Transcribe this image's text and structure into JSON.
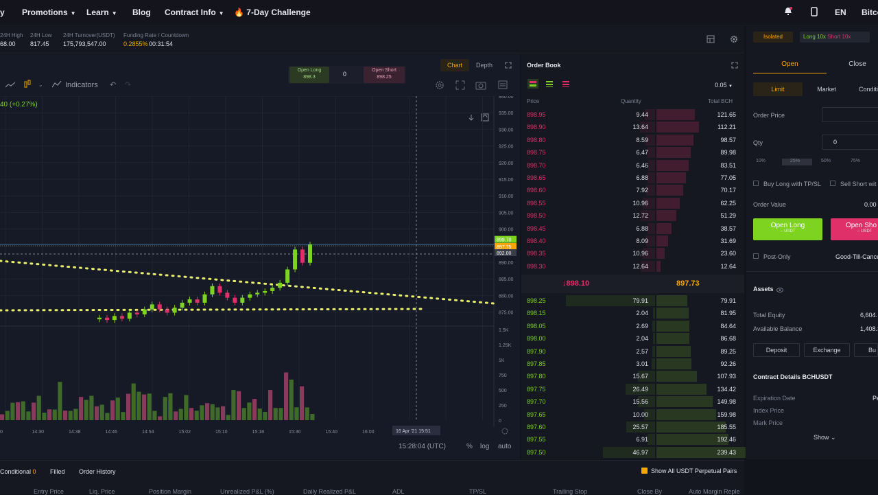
{
  "nav": {
    "brand_fragment": "y",
    "items": [
      {
        "label": "Promotions",
        "caret": true
      },
      {
        "label": "Learn",
        "caret": true
      },
      {
        "label": "Blog",
        "caret": false
      },
      {
        "label": "Contract Info",
        "caret": true
      },
      {
        "label": "7-Day Challenge",
        "caret": false,
        "icon": "fire-icon"
      }
    ],
    "lang": "EN",
    "account": "Bitco"
  },
  "ticker": {
    "high_label": "24H High",
    "high_value": "68.00",
    "low_label": "24H Low",
    "low_value": "817.45",
    "turnover_label": "24H Turnover(USDT)",
    "turnover_value": "175,793,547.00",
    "funding_label": "Funding Rate / Countdown",
    "funding_rate": "0.2855%",
    "countdown": "00:31:54"
  },
  "chart": {
    "indicators_label": "Indicators",
    "change_text": "40 (+0.27%)",
    "open_long_label": "Open Long",
    "open_long_price": "898.3",
    "qty_value": "0",
    "open_short_label": "Open Short",
    "open_short_price": "898.25",
    "tab_chart": "Chart",
    "tab_depth": "Depth",
    "clock": "15:28:04 (UTC)",
    "scale_pct": "%",
    "scale_log": "log",
    "scale_auto": "auto",
    "crosshair_date": "16 Apr '21",
    "crosshair_time": "15:51"
  },
  "chart_data": {
    "type": "candlestick",
    "y_ticks": [
      "940.00",
      "935.00",
      "930.00",
      "925.00",
      "920.00",
      "915.00",
      "910.00",
      "905.00",
      "900.00",
      "895.00",
      "890.00",
      "885.00",
      "880.00",
      "875.00"
    ],
    "vol_ticks": [
      "1.5K",
      "1.25K",
      "1K",
      "750",
      "500",
      "250",
      "0"
    ],
    "x_ticks": [
      "0",
      "14:30",
      "14:38",
      "14:46",
      "14:54",
      "15:02",
      "15:10",
      "15:18",
      "15:30",
      "15:40",
      "16:00"
    ],
    "price_tags": [
      "899.70",
      "897.75",
      "892.00"
    ],
    "ylim": [
      875,
      940
    ],
    "candles": [
      {
        "o": 876,
        "c": 876.5
      },
      {
        "o": 876.5,
        "c": 875.8
      },
      {
        "o": 875.8,
        "c": 877
      },
      {
        "o": 877,
        "c": 876.2
      },
      {
        "o": 876.2,
        "c": 878
      },
      {
        "o": 878,
        "c": 877.5
      },
      {
        "o": 877.5,
        "c": 879
      },
      {
        "o": 879,
        "c": 880.5
      },
      {
        "o": 880.5,
        "c": 879
      },
      {
        "o": 879,
        "c": 878
      },
      {
        "o": 878,
        "c": 879.5
      },
      {
        "o": 879.5,
        "c": 881
      },
      {
        "o": 881,
        "c": 882
      },
      {
        "o": 882,
        "c": 881
      },
      {
        "o": 881,
        "c": 883.5
      },
      {
        "o": 883.5,
        "c": 886
      },
      {
        "o": 886,
        "c": 884
      },
      {
        "o": 884,
        "c": 882.5
      },
      {
        "o": 882.5,
        "c": 881
      },
      {
        "o": 881,
        "c": 882.5
      },
      {
        "o": 882.5,
        "c": 883.5
      },
      {
        "o": 883.5,
        "c": 884
      },
      {
        "o": 884,
        "c": 884.5
      },
      {
        "o": 884.5,
        "c": 885.5
      },
      {
        "o": 885.5,
        "c": 887
      },
      {
        "o": 887,
        "c": 891
      },
      {
        "o": 891,
        "c": 897
      },
      {
        "o": 897,
        "c": 893
      },
      {
        "o": 893,
        "c": 898.5
      }
    ],
    "volumes": [
      120,
      80,
      200,
      310,
      150,
      90,
      260,
      180,
      70,
      140,
      220,
      330,
      110,
      160,
      90,
      240,
      300,
      180,
      130,
      200,
      150,
      170,
      260,
      140,
      210,
      380,
      420,
      190,
      250
    ]
  },
  "orderbook": {
    "title": "Order Book",
    "precision": "0.05",
    "headers": {
      "price": "Price",
      "qty": "Quantity",
      "total": "Total BCH"
    },
    "asks": [
      {
        "p": "898.95",
        "q": "9.44",
        "t": "121.65",
        "d": 0.36
      },
      {
        "p": "898.90",
        "q": "13.64",
        "t": "112.21",
        "d": 0.4
      },
      {
        "p": "898.80",
        "q": "8.59",
        "t": "98.57",
        "d": 0.35
      },
      {
        "p": "898.75",
        "q": "6.47",
        "t": "89.98",
        "d": 0.32
      },
      {
        "p": "898.70",
        "q": "6.46",
        "t": "83.51",
        "d": 0.3
      },
      {
        "p": "898.65",
        "q": "6.88",
        "t": "77.05",
        "d": 0.28
      },
      {
        "p": "898.60",
        "q": "7.92",
        "t": "70.17",
        "d": 0.25
      },
      {
        "p": "898.55",
        "q": "10.96",
        "t": "62.25",
        "d": 0.22
      },
      {
        "p": "898.50",
        "q": "12.72",
        "t": "51.29",
        "d": 0.19
      },
      {
        "p": "898.45",
        "q": "6.88",
        "t": "38.57",
        "d": 0.14
      },
      {
        "p": "898.40",
        "q": "8.09",
        "t": "31.69",
        "d": 0.11
      },
      {
        "p": "898.35",
        "q": "10.96",
        "t": "23.60",
        "d": 0.08
      },
      {
        "p": "898.30",
        "q": "12.64",
        "t": "12.64",
        "d": 0.04
      }
    ],
    "last_price": "898.10",
    "mark_price": "897.73",
    "bids": [
      {
        "p": "898.25",
        "q": "79.91",
        "t": "79.91",
        "d": 0.29
      },
      {
        "p": "898.15",
        "q": "2.04",
        "t": "81.95",
        "d": 0.3
      },
      {
        "p": "898.05",
        "q": "2.69",
        "t": "84.64",
        "d": 0.31
      },
      {
        "p": "898.00",
        "q": "2.04",
        "t": "86.68",
        "d": 0.31
      },
      {
        "p": "897.90",
        "q": "2.57",
        "t": "89.25",
        "d": 0.32
      },
      {
        "p": "897.85",
        "q": "3.01",
        "t": "92.26",
        "d": 0.33
      },
      {
        "p": "897.80",
        "q": "15.67",
        "t": "107.93",
        "d": 0.38
      },
      {
        "p": "897.75",
        "q": "26.49",
        "t": "134.42",
        "d": 0.47
      },
      {
        "p": "897.70",
        "q": "15.56",
        "t": "149.98",
        "d": 0.53
      },
      {
        "p": "897.65",
        "q": "10.00",
        "t": "159.98",
        "d": 0.56
      },
      {
        "p": "897.60",
        "q": "25.57",
        "t": "185.55",
        "d": 0.65
      },
      {
        "p": "897.55",
        "q": "6.91",
        "t": "192.46",
        "d": 0.68
      },
      {
        "p": "897.50",
        "q": "46.97",
        "t": "239.43",
        "d": 0.84
      }
    ]
  },
  "trade": {
    "mode": "Isolated",
    "leverage_long": "Long 10x",
    "leverage_short": "Short 10x",
    "tab_open": "Open",
    "tab_close": "Close",
    "type_limit": "Limit",
    "type_market": "Market",
    "type_cond": "Conditi",
    "order_price_label": "Order Price",
    "qty_label": "Qty",
    "qty_value": "0",
    "pcts": [
      "10%",
      "25%",
      "50%",
      "75%"
    ],
    "tpsl_long": "Buy Long with TP/SL",
    "tpsl_short": "Sell Short wit",
    "order_value_label": "Order Value",
    "order_value": "0.00",
    "open_long": "Open Long",
    "open_short": "Open Sho",
    "usdt_sub": "-- USDT",
    "post_only": "Post-Only",
    "tif": "Good-Till-Cance",
    "assets_title": "Assets",
    "equity_label": "Total Equity",
    "equity_value": "6,604.",
    "avail_label": "Available Balance",
    "avail_value": "1,408.3",
    "deposit": "Deposit",
    "exchange": "Exchange",
    "buy": "Bu",
    "contract_title": "Contract Details BCHUSDT",
    "exp_label": "Expiration Date",
    "exp_value": "Pe",
    "index_label": "Index Price",
    "mark_label": "Mark Price",
    "show": "Show"
  },
  "bottom": {
    "tabs": [
      {
        "label": "Conditional",
        "count": "0"
      },
      {
        "label": "Filled"
      },
      {
        "label": "Order History"
      }
    ],
    "show_all": "Show All USDT Perpetual Pairs",
    "columns": [
      "Entry Price",
      "Liq. Price",
      "Position Margin",
      "Unrealized P&L (%)",
      "Daily Realized P&L",
      "ADL",
      "TP/SL",
      "Trailing Stop",
      "Close By",
      "Auto Margin Reple"
    ]
  },
  "colors": {
    "green": "#7ed321",
    "red": "#e0306a",
    "gold": "#f7a600",
    "bg": "#12141c"
  }
}
